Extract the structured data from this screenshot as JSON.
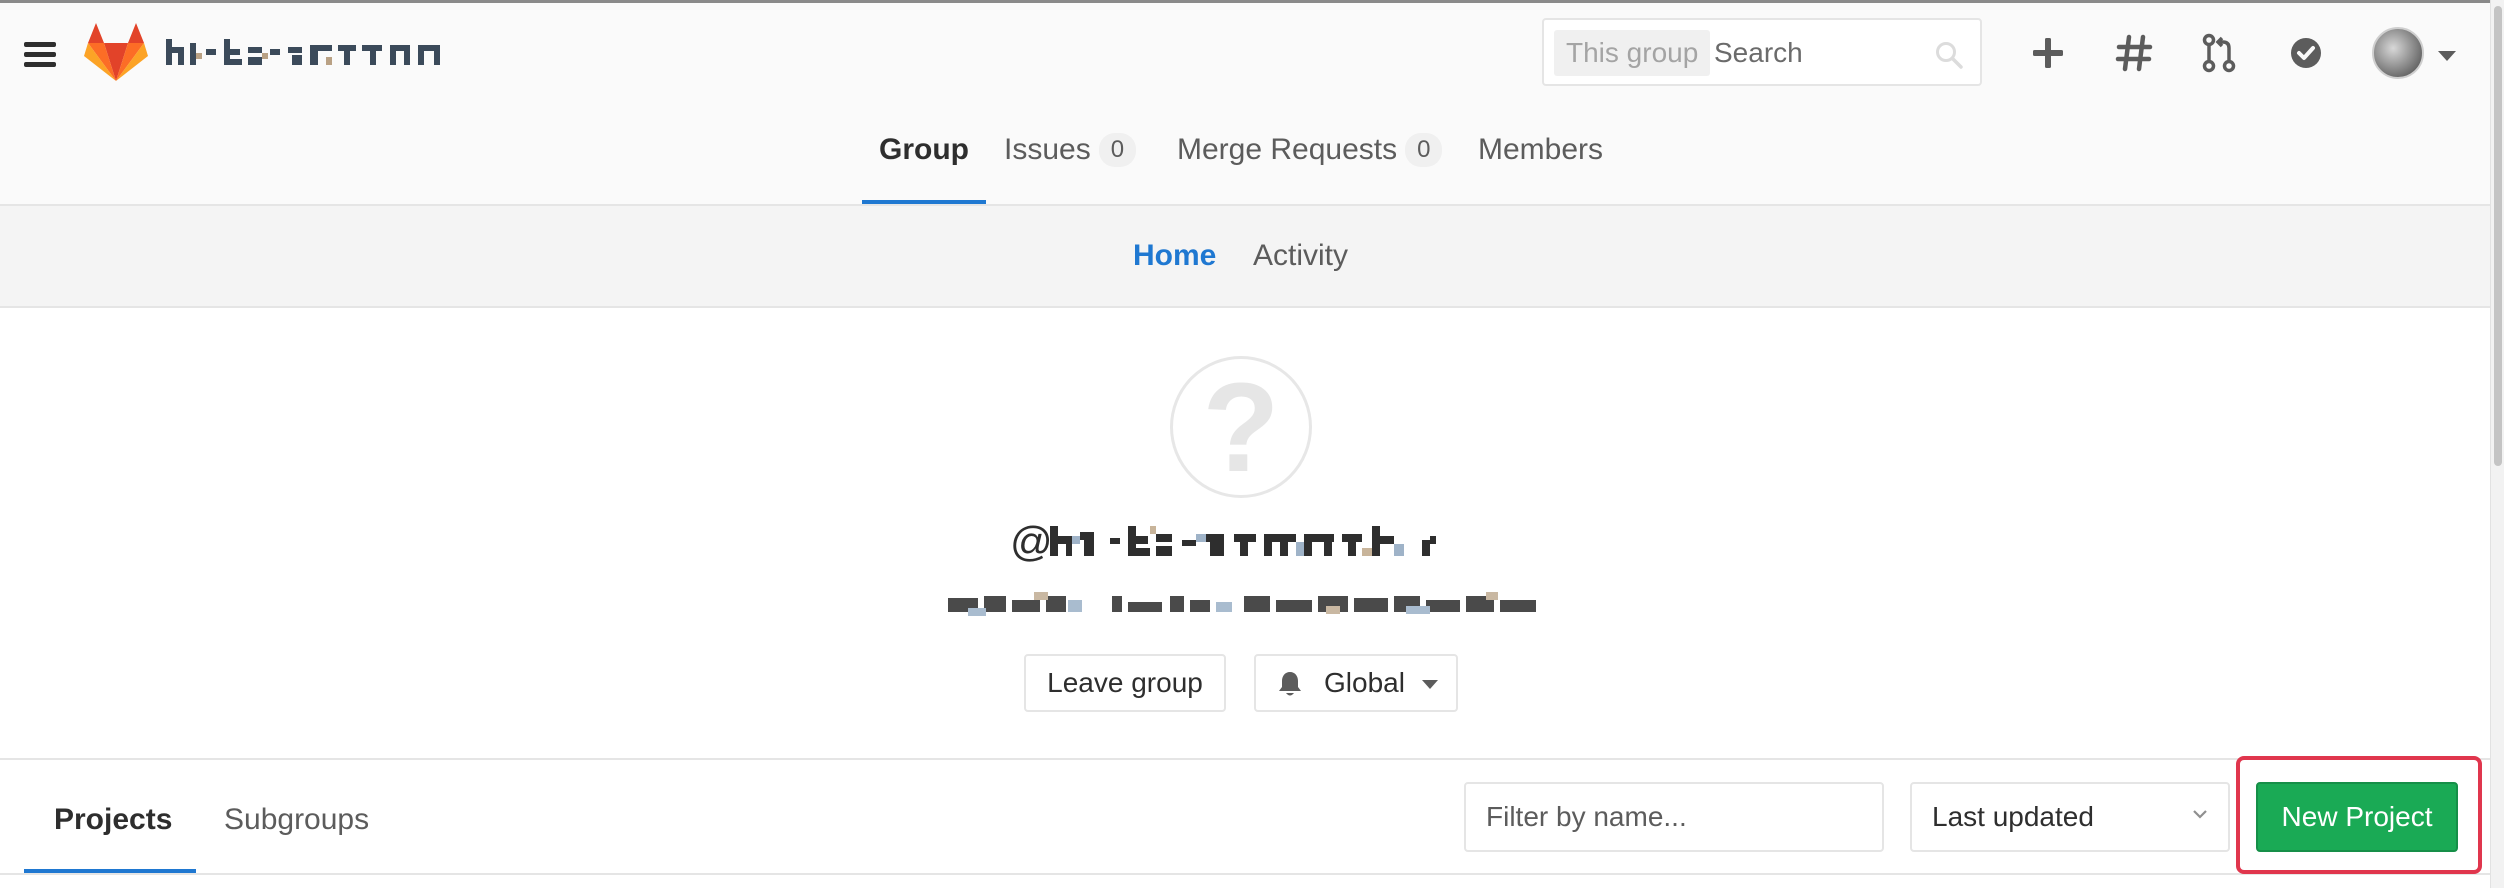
{
  "navbar": {
    "search": {
      "scope_label": "This group",
      "placeholder": "Search"
    },
    "icons": [
      "plus-icon",
      "hash-icon",
      "merge-request-icon",
      "todo-check-icon"
    ]
  },
  "group_tabs": [
    {
      "label": "Group",
      "active": true
    },
    {
      "label": "Issues",
      "count": "0"
    },
    {
      "label": "Merge Requests",
      "count": "0"
    },
    {
      "label": "Members"
    }
  ],
  "sub_tabs": [
    {
      "label": "Home",
      "active": true
    },
    {
      "label": "Activity"
    }
  ],
  "group_header": {
    "avatar_glyph": "?",
    "leave_button": "Leave group",
    "notification_button": "Global"
  },
  "projects_bar": {
    "tabs": [
      {
        "label": "Projects",
        "active": true
      },
      {
        "label": "Subgroups"
      }
    ],
    "filter_placeholder": "Filter by name...",
    "sort_value": "Last updated",
    "new_project_button": "New Project"
  },
  "colors": {
    "accent_blue": "#1f78d1",
    "primary_green": "#1aaa55",
    "highlight_red": "#e0364d",
    "gitlab_orange": "#fc6d26"
  }
}
